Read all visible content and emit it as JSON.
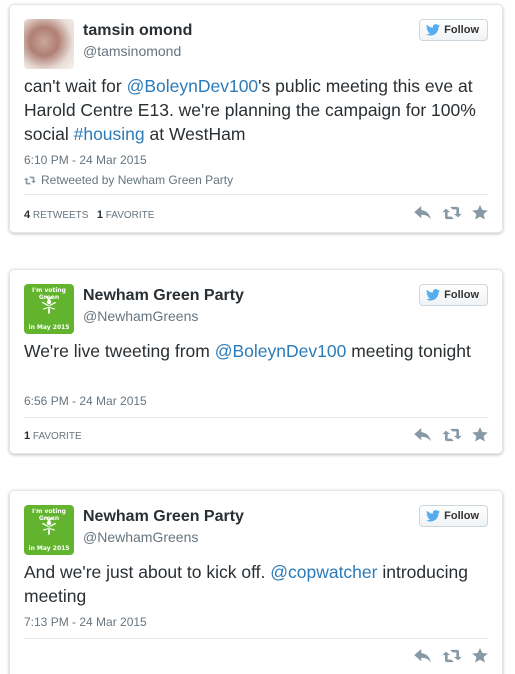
{
  "colors": {
    "link": "#2b7bb9",
    "text": "#292f33",
    "muted": "#66757f",
    "twitter_blue": "#55acee",
    "avatar_green": "#62b42f",
    "action_icon": "#8899a6"
  },
  "follow_label": "Follow",
  "tweets": [
    {
      "author_name": "tamsin omond",
      "author_handle": "@tamsinomond",
      "text": {
        "p1": "can't wait for ",
        "m1": "@BoleynDev100",
        "p2": "'s public meeting this eve at Harold Centre E13. we're planning the campaign for 100% social ",
        "h1": "#housing",
        "p3": " at WestHam"
      },
      "timestamp": "6:10 PM - 24 Mar 2015",
      "retweeted_by": "Retweeted by Newham Green Party",
      "retweets_count": "4",
      "retweets_label": "Retweets",
      "favorites_count": "1",
      "favorites_label": "Favorite"
    },
    {
      "author_name": "Newham Green Party",
      "author_handle": "@NewhamGreens",
      "avatar_text": {
        "top": "I'm voting Green",
        "bottom": "in May 2015"
      },
      "text": {
        "p1": "We're live tweeting from ",
        "m1": "@BoleynDev100",
        "p2": " meeting tonight"
      },
      "timestamp": "6:56 PM - 24 Mar 2015",
      "favorites_count": "1",
      "favorites_label": "Favorite"
    },
    {
      "author_name": "Newham Green Party",
      "author_handle": "@NewhamGreens",
      "avatar_text": {
        "top": "I'm voting Green",
        "bottom": "in May 2015"
      },
      "text": {
        "p1": "And we're just about to kick off. ",
        "m1": "@copwatcher",
        "p2": " introducing meeting"
      },
      "timestamp": "7:13 PM - 24 Mar 2015"
    }
  ],
  "icons": {
    "follow": "twitter-bird-icon",
    "retweeted": "retweet-icon",
    "reply": "reply-icon",
    "retweet": "retweet-icon",
    "favorite": "star-icon"
  }
}
